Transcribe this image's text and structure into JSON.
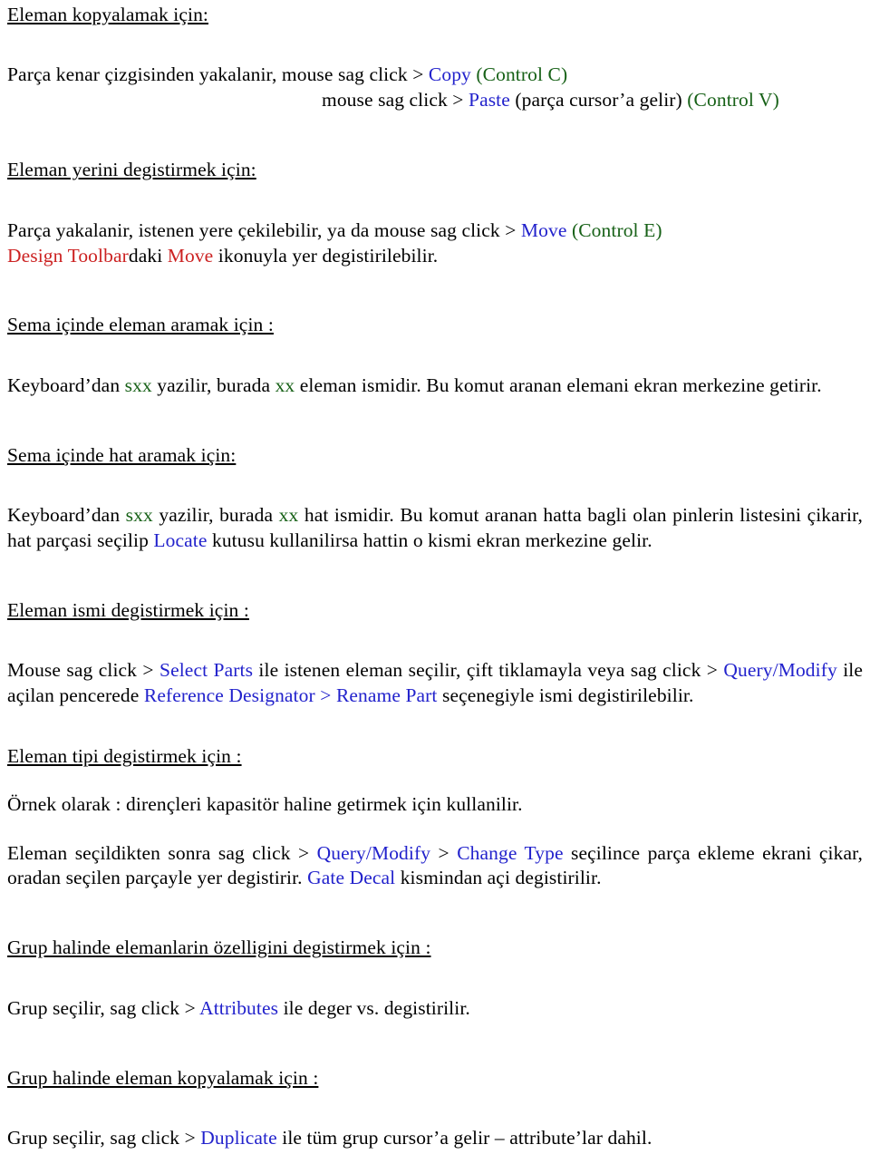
{
  "document": {
    "language": "tr",
    "colors": {
      "text": "#000000",
      "command_blue": "#2222cc",
      "shortcut_green": "#176117",
      "toolbar_red": "#cc2222",
      "background": "#ffffff"
    }
  },
  "sections": [
    {
      "id": "eleman-kopyalamak",
      "heading": "Eleman kopyalamak için:",
      "line1": {
        "a": "Parça kenar çizgisinden yakalanir,  mouse sag click > ",
        "cmd": "Copy",
        "b": " ",
        "shortcut": "(Control C)"
      },
      "line2": {
        "a": "mouse sag click > ",
        "cmd": "Paste",
        "b": " (parça cursor’a gelir) ",
        "shortcut": "(Control V)"
      }
    },
    {
      "id": "eleman-yerini-degistirmek",
      "heading": "Eleman yerini degistirmek için:",
      "line1": {
        "a": "Parça yakalanir,  istenen yere çekilebilir, ya da mouse sag click > ",
        "cmd": "Move",
        "b": " ",
        "shortcut": "(Control E)"
      },
      "line2": {
        "toolbar": "Design Toolbar",
        "a": "daki ",
        "cmd": "Move",
        "b": " ikonuyla yer degistirilebilir."
      }
    },
    {
      "id": "sema-icinde-eleman-aramak",
      "heading": "Sema içinde eleman aramak için :",
      "body": {
        "a": "Keyboard’dan ",
        "kw1": "sxx",
        "b": " yazilir, burada  ",
        "kw2": "xx",
        "c": " eleman ismidir. Bu komut aranan elemani ekran merkezine getirir."
      }
    },
    {
      "id": "sema-icinde-hat-aramak",
      "heading": "Sema içinde hat aramak için:",
      "body": {
        "a": "Keyboard’dan ",
        "kw1": "sxx",
        "b": " yazilir, burada  ",
        "kw2": "xx",
        "c": " hat ismidir. Bu komut aranan hatta bagli olan pinlerin listesini çikarir, hat parçasi seçilip ",
        "cmd": "Locate",
        "d": " kutusu kullanilirsa hattin o kismi ekran merkezine gelir."
      }
    },
    {
      "id": "eleman-ismi-degistirmek",
      "heading": "Eleman ismi degistirmek için :",
      "body": {
        "a": "Mouse sag click > ",
        "cmd1": "Select Parts",
        "b": " ile istenen eleman seçilir, çift tiklamayla veya sag click > ",
        "cmd2": "Query/Modify",
        "c": " ile açilan pencerede ",
        "cmd3": "Reference Designator",
        "d": " > ",
        "cmd4": "Rename Part",
        "e": " seçenegiyle ismi degistirilebilir."
      }
    },
    {
      "id": "eleman-tipi-degistirmek",
      "heading": "Eleman tipi degistirmek için :",
      "para1": "Örnek olarak : dirençleri kapasitör haline getirmek için kullanilir.",
      "para2": {
        "a": "Eleman seçildikten sonra sag click > ",
        "cmd1": "Query/Modify",
        "b": " > ",
        "cmd2": "Change Type",
        "c": " seçilince parça ekleme ekrani çikar, oradan seçilen parçayle yer degistirir. ",
        "cmd3": "Gate Decal",
        "d": " kismindan açi degistirilir."
      }
    },
    {
      "id": "grup-ozellik-degistirmek",
      "heading": "Grup halinde elemanlarin özelligini degistirmek için :",
      "body": {
        "a": "Grup seçilir, sag click > ",
        "cmd": "Attributes",
        "b": " ile deger vs. degistirilir."
      }
    },
    {
      "id": "grup-kopyalamak",
      "heading": "Grup halinde eleman kopyalamak için :",
      "body": {
        "a": "Grup seçilir, sag click > ",
        "cmd": "Duplicate",
        "b": " ile tüm grup cursor’a gelir – attribute’lar dahil."
      }
    }
  ]
}
